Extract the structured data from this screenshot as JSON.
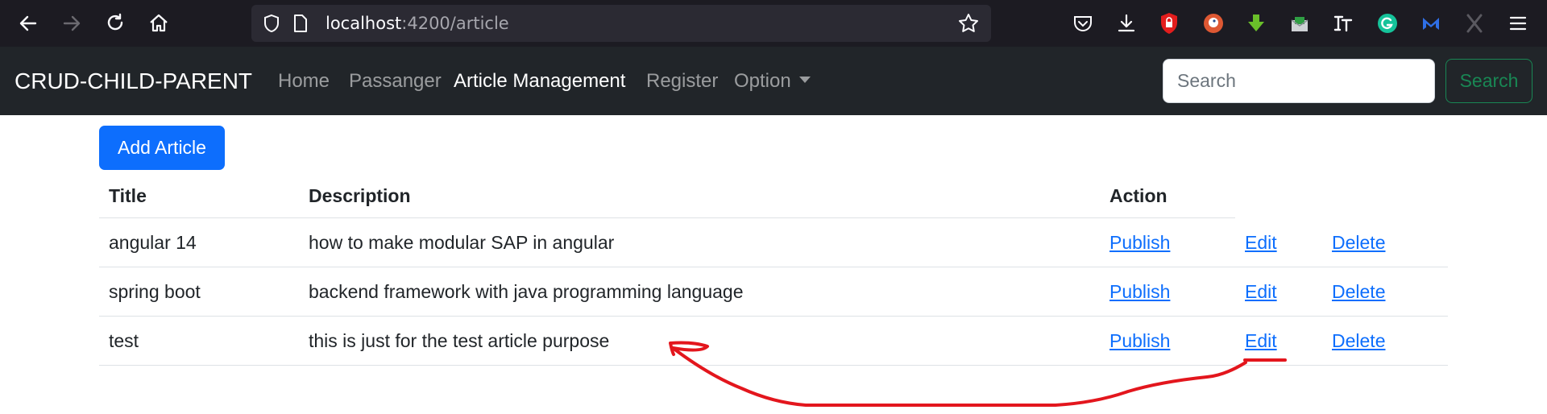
{
  "browser": {
    "url_host": "localhost",
    "url_path": ":4200/article"
  },
  "navbar": {
    "brand": "CRUD-CHILD-PARENT",
    "links": [
      "Home",
      "Passanger",
      "Article Management",
      "Register",
      "Option"
    ],
    "active": "Article Management",
    "search_placeholder": "Search",
    "search_button": "Search"
  },
  "main": {
    "add_button": "Add Article",
    "table": {
      "columns": [
        "Title",
        "Description",
        "Action"
      ],
      "rows": [
        {
          "title": "angular 14",
          "description": "how to make modular SAP in angular",
          "actions": [
            "Publish",
            "Edit",
            "Delete"
          ]
        },
        {
          "title": "spring boot",
          "description": "backend framework with java programming language",
          "actions": [
            "Publish",
            "Edit",
            "Delete"
          ]
        },
        {
          "title": "test",
          "description": "this is just for the test article purpose",
          "actions": [
            "Publish",
            "Edit",
            "Delete"
          ]
        }
      ]
    }
  },
  "colors": {
    "navbar_bg": "#212529",
    "primary": "#0d6efd",
    "success": "#198754",
    "annotation": "#e3161d"
  }
}
